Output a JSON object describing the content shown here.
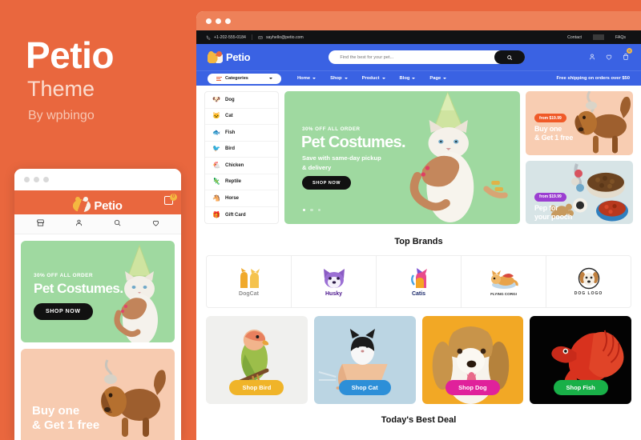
{
  "promo": {
    "title": "Petio",
    "subtitle": "Theme",
    "author": "By wpbingo",
    "accent_orange": "#E9673E",
    "accent_blue": "#3A62E3"
  },
  "mobile": {
    "logo_text": "Petio",
    "cart_count": "0",
    "icons": [
      "store-icon",
      "user-icon",
      "search-icon",
      "heart-icon"
    ],
    "hero": {
      "eyebrow": "30% OFF ALL ORDER",
      "title": "Pet Costumes.",
      "cta": "SHOP NOW"
    },
    "promo": {
      "line1": "Buy one",
      "line2": "& Get 1 free"
    }
  },
  "desktop": {
    "topbar": {
      "phone": "+1-202-555-0184",
      "email": "sayhello@petio.com",
      "links": [
        "Contact",
        "FAQs"
      ]
    },
    "header": {
      "logo_text": "Petio",
      "search_placeholder": "Find the best for your pet...",
      "search_value": "",
      "cart_count": "0",
      "icons": [
        "user-icon",
        "heart-icon",
        "cart-icon"
      ]
    },
    "nav": {
      "categories_label": "Categories",
      "items": [
        {
          "label": "Home"
        },
        {
          "label": "Shop"
        },
        {
          "label": "Product"
        },
        {
          "label": "Blog"
        },
        {
          "label": "Page"
        }
      ],
      "shipping_note": "Free shipping on orders over $50"
    },
    "categories": [
      {
        "label": "Dog",
        "emoji": "🐶"
      },
      {
        "label": "Cat",
        "emoji": "🐱"
      },
      {
        "label": "Fish",
        "emoji": "🐟"
      },
      {
        "label": "Bird",
        "emoji": "🐦"
      },
      {
        "label": "Chicken",
        "emoji": "🐔"
      },
      {
        "label": "Reptile",
        "emoji": "🦎"
      },
      {
        "label": "Horse",
        "emoji": "🐴"
      },
      {
        "label": "Gift Card",
        "emoji": "🎁"
      }
    ],
    "hero": {
      "eyebrow": "30% OFF ALL ORDER",
      "title": "Pet Costumes.",
      "sub_line1": "Save with same-day pickup",
      "sub_line2": "& delivery",
      "cta": "SHOP NOW",
      "slide_count": 3,
      "active_slide": 1
    },
    "promos": [
      {
        "badge": "from $19.99",
        "line1": "Buy one",
        "line2": "& Get 1 free",
        "badge_color": "#F05A28",
        "bg": "#F8CDB2"
      },
      {
        "badge": "from $19.99",
        "line1": "Pep for",
        "line2": "your pooch",
        "badge_color": "#9B3FD1",
        "bg": "#D7E4E6"
      }
    ],
    "brands": {
      "title": "Top Brands",
      "items": [
        {
          "name": "DogCat",
          "color": "#8E8E8E"
        },
        {
          "name": "Husky",
          "color": "#4A148C"
        },
        {
          "name": "Catis",
          "color": "#1B2A6B"
        },
        {
          "name": "FLYING CORGI",
          "color": "#333333"
        },
        {
          "name": "DOG LOGO",
          "color": "#333333"
        }
      ]
    },
    "shop_cards": [
      {
        "label": "Shop Bird",
        "bg": "#F0F0EE",
        "btn": "#F0B429"
      },
      {
        "label": "Shop Cat",
        "bg": "#BBD5E3",
        "btn": "#2D8FD8"
      },
      {
        "label": "Shop Dog",
        "bg": "#F2A825",
        "btn": "#E0219B"
      },
      {
        "label": "Shop Fish",
        "bg": "#030303",
        "btn": "#19B048"
      }
    ],
    "deal_title": "Today's Best Deal"
  }
}
